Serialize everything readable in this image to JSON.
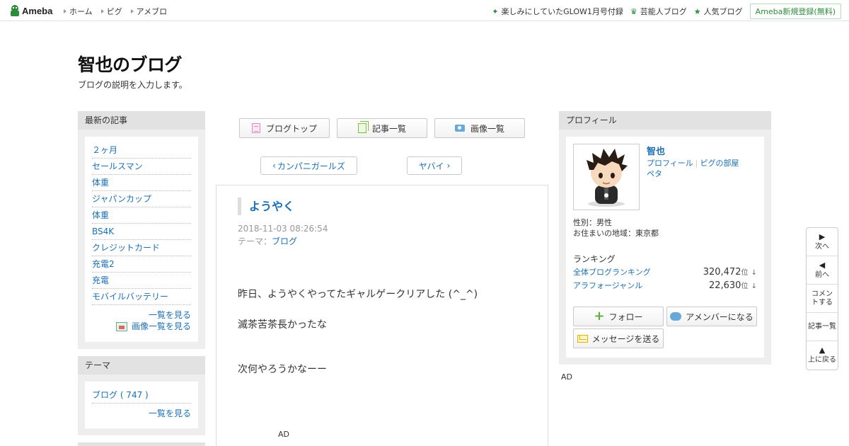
{
  "topbar": {
    "logo": "Ameba",
    "nav": [
      "ホーム",
      "ピグ",
      "アメブロ"
    ],
    "right_links": [
      {
        "icon": "sparkle-icon",
        "label": "楽しみにしていたGLOW1月号付録"
      },
      {
        "icon": "crown-icon",
        "label": "芸能人ブログ"
      },
      {
        "icon": "star-icon",
        "label": "人気ブログ"
      }
    ],
    "register": "Ameba新規登録(無料)"
  },
  "blog": {
    "title": "智也のブログ",
    "description": "ブログの説明を入力します。"
  },
  "sidebar": {
    "recent": {
      "heading": "最新の記事",
      "items": [
        "２ヶ月",
        "セールスマン",
        "体重",
        "ジャパンカップ",
        "体重",
        "BS4K",
        "クレジットカード",
        "充電2",
        "充電",
        "モバイルバッテリー"
      ],
      "more": "一覧を見る",
      "image_more": "画像一覧を見る"
    },
    "theme": {
      "heading": "テーマ",
      "items": [
        "ブログ ( 747 )"
      ],
      "more": "一覧を見る"
    }
  },
  "center": {
    "buttons": [
      "ブログトップ",
      "記事一覧",
      "画像一覧"
    ],
    "prev": "カンパニガールズ",
    "next": "ヤバイ",
    "article": {
      "title": "ようやく",
      "date": "2018-11-03 08:26:54",
      "theme_label": "テーマ：",
      "theme": "ブログ",
      "body": [
        "昨日、ようやくやってたギャルゲークリアした (^_^)",
        "滅茶苦茶長かったな",
        "次何やろうかなーー"
      ],
      "ad": "AD"
    }
  },
  "profile": {
    "heading": "プロフィール",
    "name": "智也",
    "links": [
      "プロフィール",
      "ピグの部屋",
      "ペタ"
    ],
    "gender": "性別：男性",
    "area": "お住まいの地域：東京都",
    "ranking_title": "ランキング",
    "rankings": [
      {
        "label": "全体ブログランキング",
        "value": "320,472",
        "unit": "位",
        "trend": "↓"
      },
      {
        "label": "アラフォージャンル",
        "value": "22,630",
        "unit": "位",
        "trend": "↓"
      }
    ],
    "follow": "フォロー",
    "amember": "アメンバーになる",
    "message": "メッセージを送る",
    "ad": "AD"
  },
  "float_nav": {
    "next": "次へ",
    "prev": "前へ",
    "comment": "コメントする",
    "list": "記事一覧",
    "top": "上に戻る"
  }
}
